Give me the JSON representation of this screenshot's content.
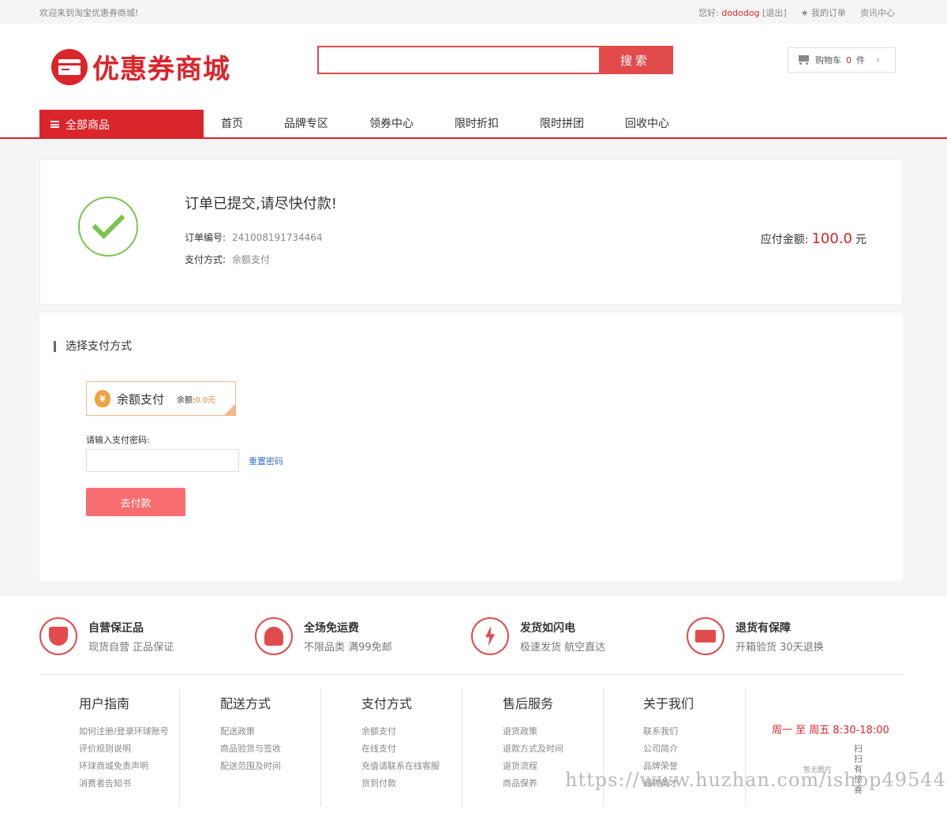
{
  "topbar": {
    "welcome": "欢迎来到淘宝优惠券商城!",
    "greeting": "您好:",
    "username": "dododog",
    "logout": "[退出]",
    "my_orders": "我的订单",
    "news": "资讯中心"
  },
  "header": {
    "logo_text": "优惠券商城",
    "search_placeholder": "",
    "search_button": "搜索",
    "cart_label": "购物车",
    "cart_count": "0",
    "cart_unit": "件"
  },
  "nav": {
    "all_goods": "全部商品",
    "links": [
      "首页",
      "品牌专区",
      "领券中心",
      "限时折扣",
      "限时拼团",
      "回收中心"
    ]
  },
  "order": {
    "title": "订单已提交,请尽快付款!",
    "number_label": "订单编号:",
    "number": "241008191734464",
    "method_label": "支付方式:",
    "method": "余额支付",
    "amount_label": "应付金额:",
    "amount": "100.0",
    "currency": "元"
  },
  "payment": {
    "section_title": "选择支付方式",
    "option_name": "余额支付",
    "balance_label": "余额:",
    "balance_value": "0.0元",
    "password_label": "请输入支付密码:",
    "reset_password": "重置密码",
    "pay_button": "去付款"
  },
  "guarantees": [
    {
      "title": "自营保正品",
      "sub": "现货自营 正品保证",
      "icon": "shield-icon"
    },
    {
      "title": "全场免运费",
      "sub": "不限品类 满99免邮",
      "icon": "hands-heart-icon"
    },
    {
      "title": "发货如闪电",
      "sub": "极速发货 航空直达",
      "icon": "lightning-icon"
    },
    {
      "title": "退货有保障",
      "sub": "开箱验货 30天退换",
      "icon": "truck-icon"
    }
  ],
  "footer_columns": [
    {
      "title": "用户指南",
      "links": [
        "如何注册/登录环球账号",
        "评价规则说明",
        "环球商城免责声明",
        "消费者告知书"
      ]
    },
    {
      "title": "配送方式",
      "links": [
        "配送政策",
        "商品验货与签收",
        "配送范围及时间"
      ]
    },
    {
      "title": "支付方式",
      "links": [
        "余额支付",
        "在线支付",
        "充值请联系在线客服",
        "货到付款"
      ]
    },
    {
      "title": "售后服务",
      "links": [
        "退货政策",
        "退款方式及时间",
        "退货流程",
        "商品保养"
      ]
    },
    {
      "title": "关于我们",
      "links": [
        "联系我们",
        "公司简介",
        "品牌荣誉",
        "诚聘英才"
      ]
    }
  ],
  "footer_service": {
    "hours": "周一 至 周五   8:30-18:00",
    "qr_text": "扫扫有惊喜",
    "no_image": "暂无图片"
  },
  "watermark": "https://www.huzhan.com/ishop49544"
}
